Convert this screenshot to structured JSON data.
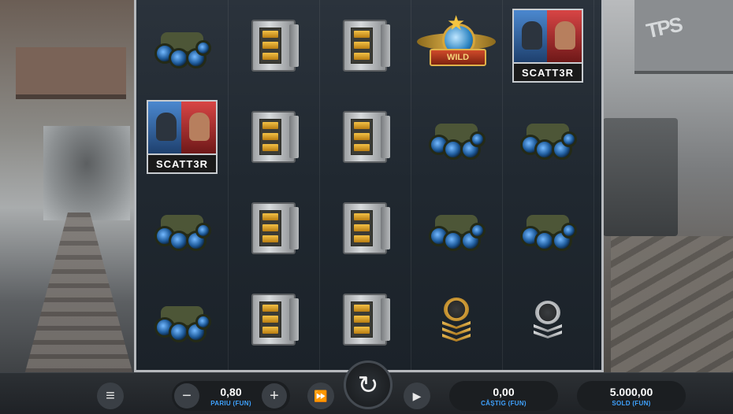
{
  "reels": [
    [
      "binoculars",
      "scatter",
      "binoculars",
      "binoculars"
    ],
    [
      "safe",
      "safe",
      "safe",
      "safe"
    ],
    [
      "safe",
      "safe",
      "safe",
      "safe"
    ],
    [
      "wild",
      "binoculars",
      "binoculars",
      "gold-badge"
    ],
    [
      "scatter",
      "binoculars",
      "binoculars",
      "silver-badge"
    ]
  ],
  "symbols": {
    "scatter_label": "SCATT3R",
    "wild_label": "WILD"
  },
  "background": {
    "graffiti_text": "TPS"
  },
  "controls": {
    "menu_icon": "≡",
    "minus_icon": "−",
    "plus_icon": "+",
    "turbo_icon": "⏩",
    "spin_icon": "↻",
    "autoplay_icon": "▶",
    "bet_value": "0,80",
    "bet_label": "PARIU (FUN)",
    "win_value": "0,00",
    "win_label": "CÂȘTIG (FUN)",
    "balance_value": "5.000,00",
    "balance_label": "SOLD (FUN)"
  },
  "colors": {
    "accent_label": "#3fa2ff",
    "reel_bg": "#222a32",
    "frame": "#b6b9bd"
  }
}
